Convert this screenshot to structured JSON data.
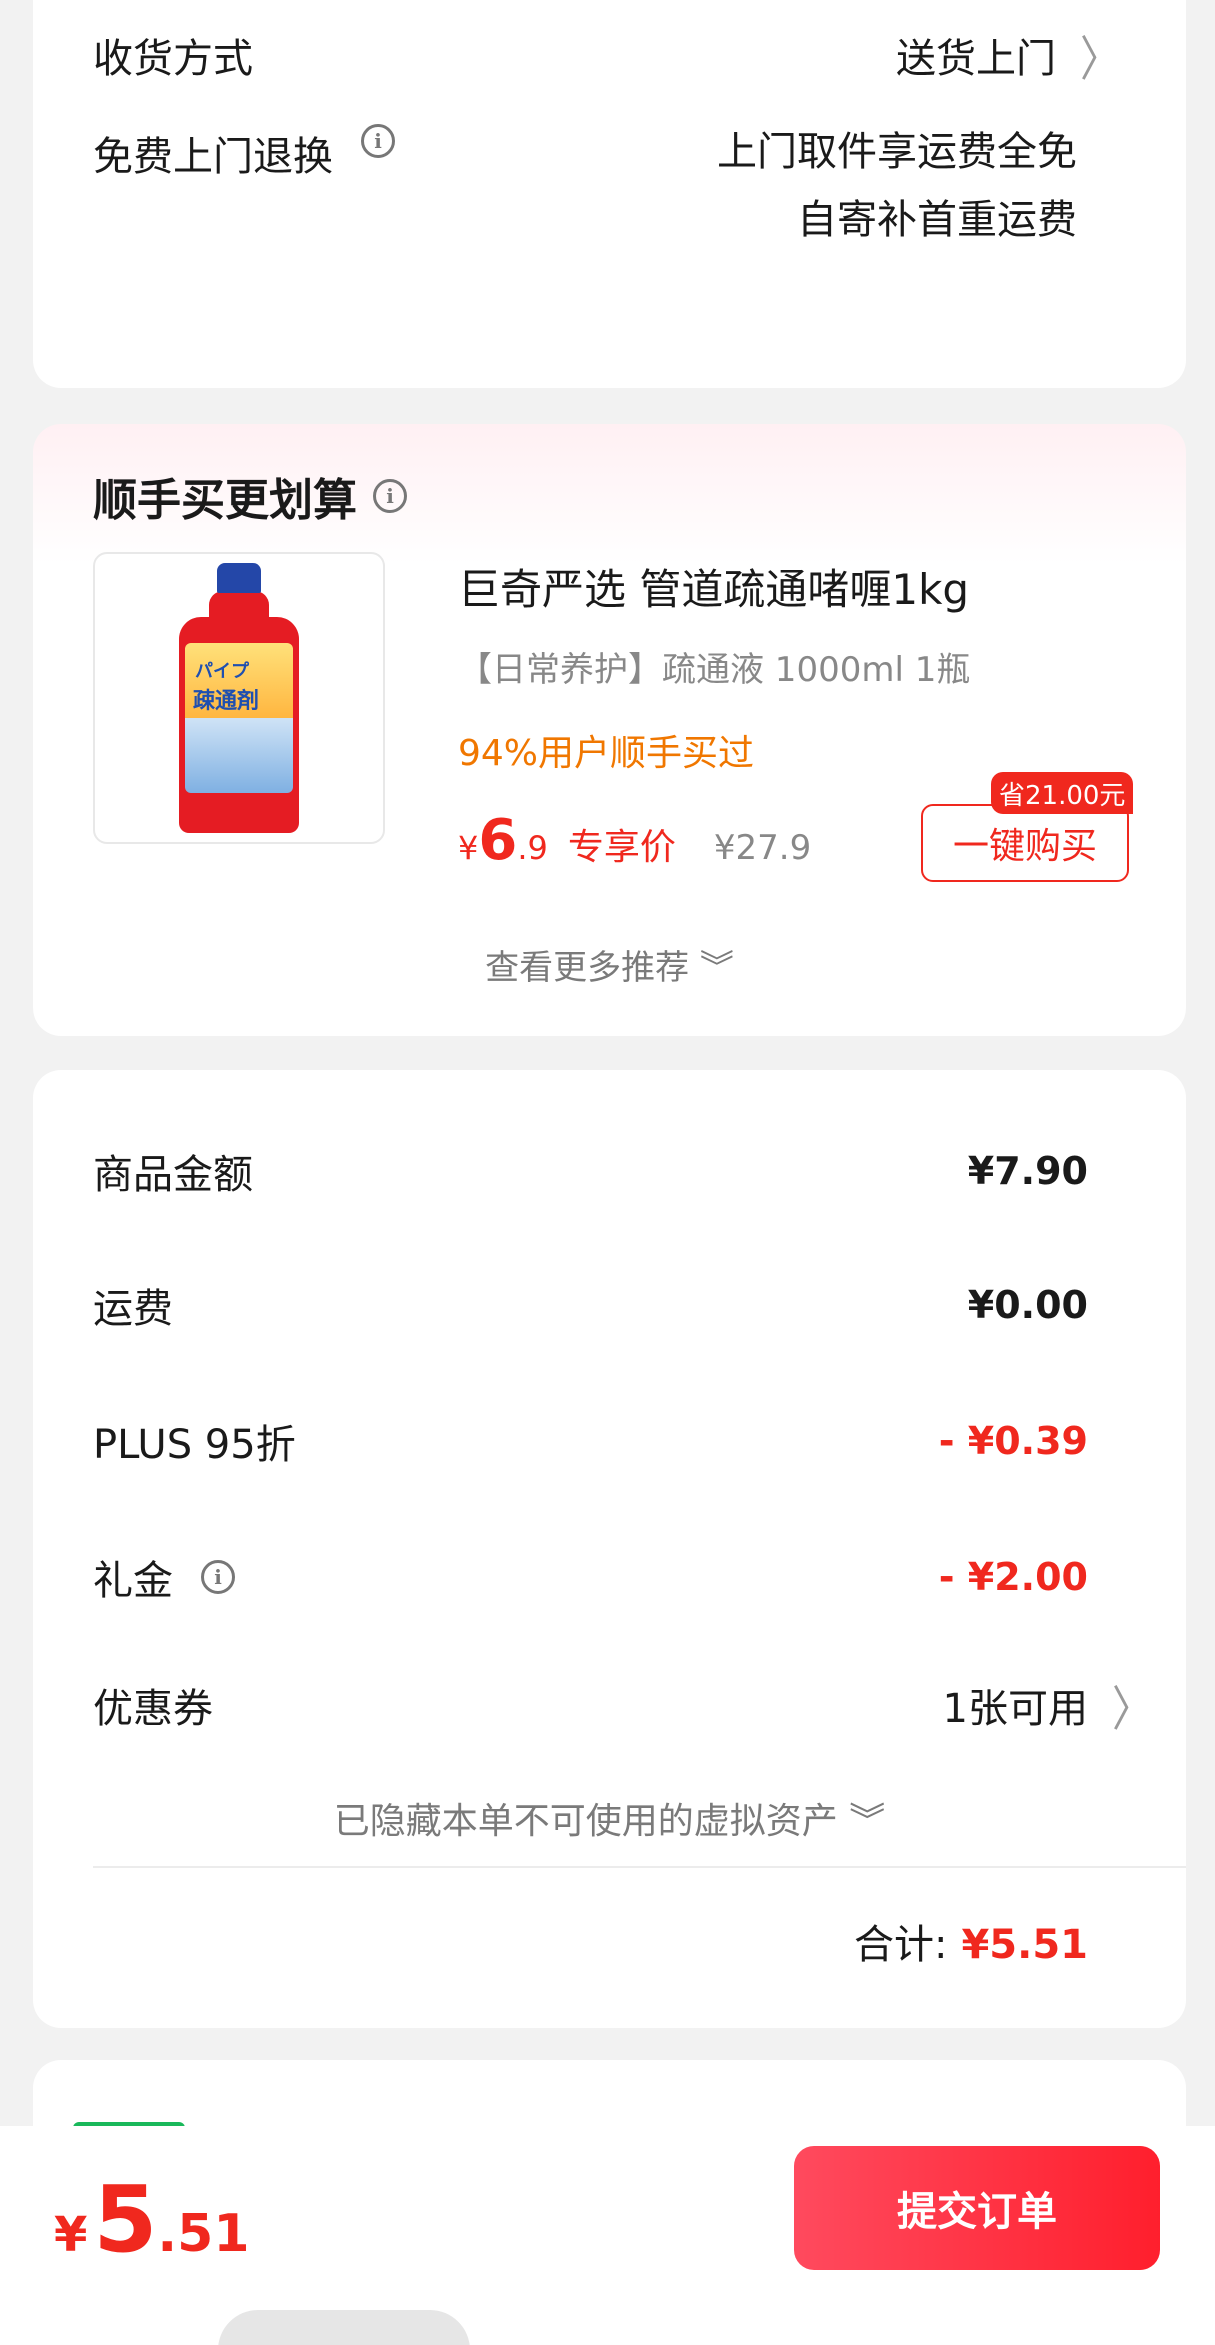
{
  "delivery": {
    "method_label": "收货方式",
    "method_value": "送货上门",
    "return_label": "免费上门退换",
    "return_line1": "上门取件享运费全免",
    "return_line2": "自寄补首重运费"
  },
  "upsell": {
    "title": "顺手买更划算",
    "product_title": "巨奇严选 管道疏通啫喱1kg",
    "product_sub": "【日常养护】疏通液 1000ml 1瓶",
    "hot_text": "94%用户顺手买过",
    "price_currency": "¥",
    "price_int": "6",
    "price_dec": ".9",
    "price_tag": "专享价",
    "orig_price": "¥27.9",
    "save_badge": "省21.00元",
    "buy_label": "一键购买",
    "more_label": "查看更多推荐 ︾",
    "image_text": {
      "line1": "パイプ",
      "line2": "疎通剤"
    }
  },
  "summary": {
    "goods_label": "商品金额",
    "goods_value": "¥7.90",
    "ship_label": "运费",
    "ship_value": "¥0.00",
    "plus_label": "PLUS 95折",
    "plus_value": "- ¥0.39",
    "gift_label": "礼金",
    "gift_value": "- ¥2.00",
    "coupon_label": "优惠券",
    "coupon_value": "1张可用",
    "hidden_label": "已隐藏本单不可使用的虚拟资产 ︾",
    "total_label": "合计:",
    "total_value": "¥5.51"
  },
  "bottom": {
    "currency": "¥",
    "int": "5",
    "dec": ".51",
    "submit_label": "提交订单"
  },
  "colors": {
    "accent_red": "#f0281e",
    "orange": "#f07700",
    "background": "#f2f2f2"
  }
}
